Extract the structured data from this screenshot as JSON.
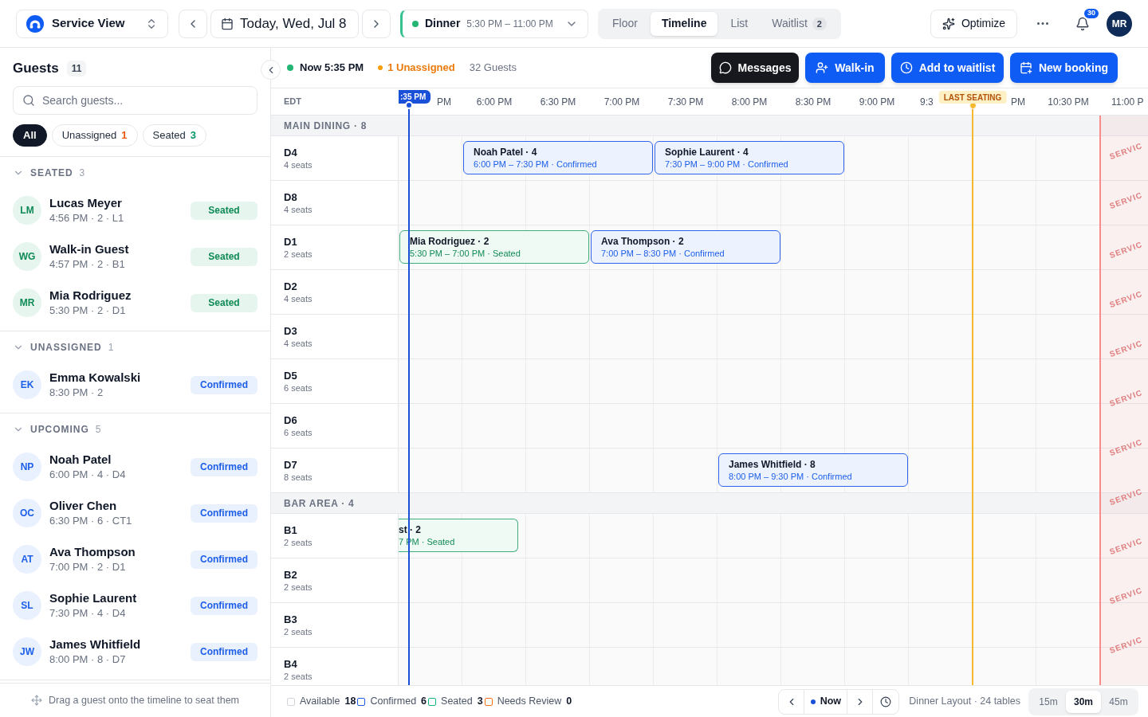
{
  "top_bar": {
    "view_select": {
      "label": "Service View"
    },
    "date": {
      "label": "Today, Wed, Jul 8"
    },
    "shift_select": {
      "name": "Dinner",
      "hours": "5:30 PM – 11:00 PM"
    },
    "view_tabs": [
      {
        "label": "Floor",
        "selected": false
      },
      {
        "label": "Timeline",
        "selected": true
      },
      {
        "label": "List",
        "selected": false
      },
      {
        "label": "Waitlist",
        "count": "2",
        "selected": false
      }
    ],
    "optimize_button": {
      "label": "Optimize"
    },
    "notifications": {
      "count": "30"
    },
    "user": {
      "initials": "MR"
    }
  },
  "sidebar": {
    "title": "Guests",
    "count": "11",
    "search": {
      "placeholder": "Search guests..."
    },
    "filters": [
      {
        "label": "All",
        "selected": true
      },
      {
        "label": "Unassigned",
        "count": "1",
        "color": "#ea580c",
        "selected": false
      },
      {
        "label": "Seated",
        "count": "3",
        "color": "#059669",
        "selected": false
      }
    ],
    "sections": [
      {
        "title": "SEATED",
        "count": "3",
        "expanded": true,
        "guests": [
          {
            "initials": "LM",
            "name": "Lucas Meyer",
            "meta": "4:56 PM · 2 · L1",
            "status": "Seated",
            "kind": "seated"
          },
          {
            "initials": "WG",
            "name": "Walk-in Guest",
            "meta": "4:57 PM · 2 · B1",
            "status": "Seated",
            "kind": "seated"
          },
          {
            "initials": "MR",
            "name": "Mia Rodriguez",
            "meta": "5:30 PM · 2 · D1",
            "status": "Seated",
            "kind": "seated"
          }
        ]
      },
      {
        "title": "UNASSIGNED",
        "count": "1",
        "expanded": true,
        "guests": [
          {
            "initials": "EK",
            "name": "Emma Kowalski",
            "meta": "8:30 PM · 2",
            "status": "Confirmed",
            "kind": "confirmed"
          }
        ]
      },
      {
        "title": "UPCOMING",
        "count": "5",
        "expanded": true,
        "guests": [
          {
            "initials": "NP",
            "name": "Noah Patel",
            "meta": "6:00 PM · 4 · D4",
            "status": "Confirmed",
            "kind": "confirmed"
          },
          {
            "initials": "OC",
            "name": "Oliver Chen",
            "meta": "6:30 PM · 6 · CT1",
            "status": "Confirmed",
            "kind": "confirmed"
          },
          {
            "initials": "AT",
            "name": "Ava Thompson",
            "meta": "7:00 PM · 2 · D1",
            "status": "Confirmed",
            "kind": "confirmed"
          },
          {
            "initials": "SL",
            "name": "Sophie Laurent",
            "meta": "7:30 PM · 4 · D4",
            "status": "Confirmed",
            "kind": "confirmed"
          },
          {
            "initials": "JW",
            "name": "James Whitfield",
            "meta": "8:00 PM · 8 · D7",
            "status": "Confirmed",
            "kind": "confirmed"
          }
        ]
      }
    ],
    "hint": "Drag a guest onto the timeline to seat them"
  },
  "toolbar": {
    "now": "Now 5:35 PM",
    "unassigned": "1 Unassigned",
    "guests": "32 Guests",
    "actions": [
      {
        "label": "Messages",
        "kind": "messages"
      },
      {
        "label": "Walk-in",
        "kind": "walk_in"
      },
      {
        "label": "Add to waitlist",
        "kind": "waitlist"
      },
      {
        "label": "New booking",
        "kind": "booking"
      }
    ]
  },
  "timeline": {
    "timezone": "EDT",
    "now_marker": {
      "badge": ":35 PM"
    },
    "slots": [
      {
        "label": "PM",
        "kind": "tail"
      },
      {
        "label": "6:00 PM",
        "kind": "full"
      },
      {
        "label": "6:30 PM",
        "kind": "full"
      },
      {
        "label": "7:00 PM",
        "kind": "full"
      },
      {
        "label": "7:30 PM",
        "kind": "full"
      },
      {
        "label": "8:00 PM",
        "kind": "full"
      },
      {
        "label": "8:30 PM",
        "kind": "full"
      },
      {
        "label": "9:00 PM",
        "kind": "full"
      },
      {
        "label": "9:3",
        "kind": "head"
      },
      {
        "label": "PM",
        "kind": "tail",
        "last_seating": {
          "label": "LAST SEATING"
        }
      },
      {
        "label": "10:30 PM",
        "kind": "full"
      },
      {
        "label": "11:00 P",
        "kind": "head",
        "service_end": {
          "marks": [
            "SERVIC",
            "SERVIC",
            "SERVIC",
            "SERVIC",
            "SERVIC",
            "SERVIC",
            "SERVIC",
            "SERVIC",
            "SERVIC",
            "SERVIC",
            "SERVIC"
          ]
        }
      }
    ],
    "areas": [
      {
        "title": "MAIN DINING · 8",
        "tables": [
          {
            "name": "D4",
            "seats": "4 seats",
            "bookings": [
              {
                "title": "Noah Patel · 4",
                "detail": "6:00 PM – 7:30 PM · Confirmed",
                "kind": "confirmed",
                "open_start": false
              },
              {
                "title": "Sophie Laurent · 4",
                "detail": "7:30 PM – 9:00 PM · Confirmed",
                "kind": "confirmed",
                "open_start": false
              }
            ]
          },
          {
            "name": "D8",
            "seats": "4 seats"
          },
          {
            "name": "D1",
            "seats": "2 seats",
            "bookings": [
              {
                "title": "Mia Rodriguez · 2",
                "detail": "5:30 PM – 7:00 PM · Seated",
                "kind": "seated",
                "open_start": false
              },
              {
                "title": "Ava Thompson · 2",
                "detail": "7:00 PM – 8:30 PM · Confirmed",
                "kind": "confirmed",
                "open_start": false
              }
            ]
          },
          {
            "name": "D2",
            "seats": "4 seats"
          },
          {
            "name": "D3",
            "seats": "4 seats"
          },
          {
            "name": "D5",
            "seats": "6 seats"
          },
          {
            "name": "D6",
            "seats": "6 seats"
          },
          {
            "name": "D7",
            "seats": "8 seats",
            "bookings": [
              {
                "title": "James Whitfield · 8",
                "detail": "8:00 PM – 9:30 PM · Confirmed",
                "kind": "confirmed",
                "open_start": false
              }
            ]
          }
        ]
      },
      {
        "title": "BAR AREA · 4",
        "tables": [
          {
            "name": "B1",
            "seats": "2 seats",
            "bookings": [
              {
                "title": "st · 2",
                "detail": "7 PM · Seated",
                "kind": "seated",
                "open_start": true,
                "level": 0.16
              }
            ]
          },
          {
            "name": "B2",
            "seats": "2 seats"
          },
          {
            "name": "B3",
            "seats": "2 seats"
          },
          {
            "name": "B4",
            "seats": "2 seats"
          }
        ]
      }
    ]
  },
  "footer": {
    "legend": [
      {
        "label": "Available",
        "count": "18",
        "color": "#d1d5db"
      },
      {
        "label": "Confirmed",
        "count": "6",
        "color": "#1d5fe8"
      },
      {
        "label": "Seated",
        "count": "3",
        "color": "#10b981"
      },
      {
        "label": "Needs Review",
        "count": "0",
        "color": "#f97316"
      }
    ],
    "now_button": "Now",
    "layout": "Dinner Layout · 24 tables",
    "zoom": [
      {
        "label": "15m",
        "selected": false
      },
      {
        "label": "30m",
        "selected": true
      },
      {
        "label": "45m",
        "selected": false
      }
    ]
  }
}
